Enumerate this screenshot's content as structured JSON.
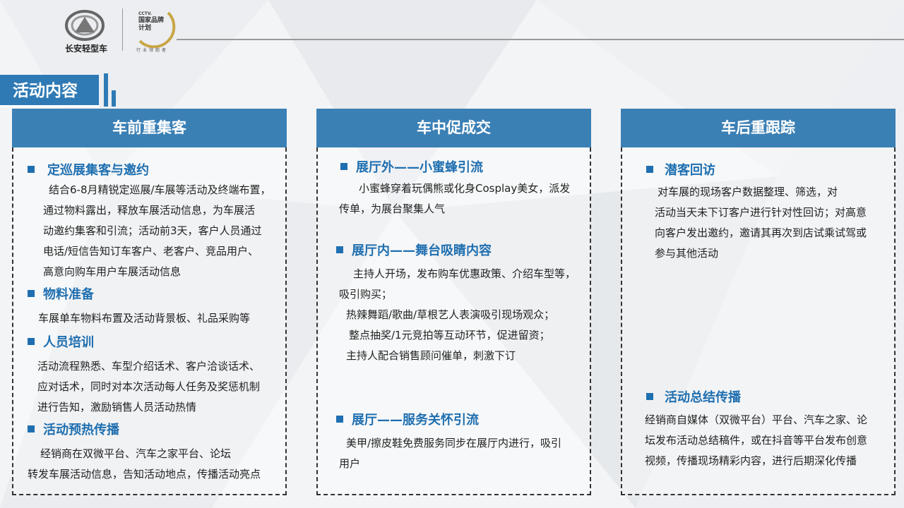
{
  "header": {
    "brand_name": "长安轻型车",
    "cctv_line1": "CCTV.",
    "cctv_line2": "国家品牌计划",
    "cctv_line3": "行业领跑者"
  },
  "section_title": "活动内容",
  "columns": [
    {
      "title": "车前重集客",
      "items": [
        {
          "title": "定巡展集客与邀约",
          "lines": [
            "结合6-8月精锐定巡展/车展等活动及终端布置，",
            "通过物料露出，释放车展活动信息，为车展活",
            "动邀约集客和引流；活动前3天，客户人员通过",
            "电话/短信告知订车客户、老客户、竞品用户、",
            "高意向购车用户车展活动信息"
          ]
        },
        {
          "title": "物料准备",
          "lines": [
            "车展单车物料布置及活动背景板、礼品采购等"
          ]
        },
        {
          "title": "人员培训",
          "lines": [
            "活动流程熟悉、车型介绍话术、客户洽谈话术、",
            "应对话术，同时对本次活动每人任务及奖惩机制",
            "进行告知，激励销售人员活动热情"
          ]
        },
        {
          "title": "活动预热传播",
          "lines": [
            "经销商在双微平台、汽车之家平台、论坛",
            "转发车展活动信息，告知活动地点，传播活动亮点"
          ]
        }
      ]
    },
    {
      "title": "车中促成交",
      "items": [
        {
          "title": "展厅外——小蜜蜂引流",
          "lines": [
            "小蜜蜂穿着玩偶熊或化身Cosplay美女，派发",
            "传单，为展台聚集人气"
          ]
        },
        {
          "title": "展厅内——舞台吸睛内容",
          "lines": [
            "主持人开场，发布购车优惠政策、介绍车型等，",
            "吸引购买；",
            "热辣舞蹈/歌曲/草根艺人表演吸引现场观众；",
            "整点抽奖/1元竞拍等互动环节，促进留资；",
            "主持人配合销售顾问催单，刺激下订"
          ]
        },
        {
          "title": "展厅——服务关怀引流",
          "lines": [
            "美甲/擦皮鞋免费服务同步在展厅内进行，吸引",
            "用户"
          ]
        }
      ]
    },
    {
      "title": "车后重跟踪",
      "items": [
        {
          "title": "潜客回访",
          "lines": [
            "对车展的现场客户数据整理、筛选，对",
            "活动当天未下订客户进行针对性回访；对高意",
            "向客户发出邀约，邀请其再次到店试乘试驾或",
            "参与其他活动"
          ]
        },
        {
          "title": "活动总结传播",
          "lines": [
            "经销商自媒体（双微平台）平台、汽车之家、论",
            "坛发布活动总结稿件，或在抖音等平台发布创意",
            "视频，传播现场精彩内容，进行后期深化传播"
          ]
        }
      ]
    }
  ]
}
